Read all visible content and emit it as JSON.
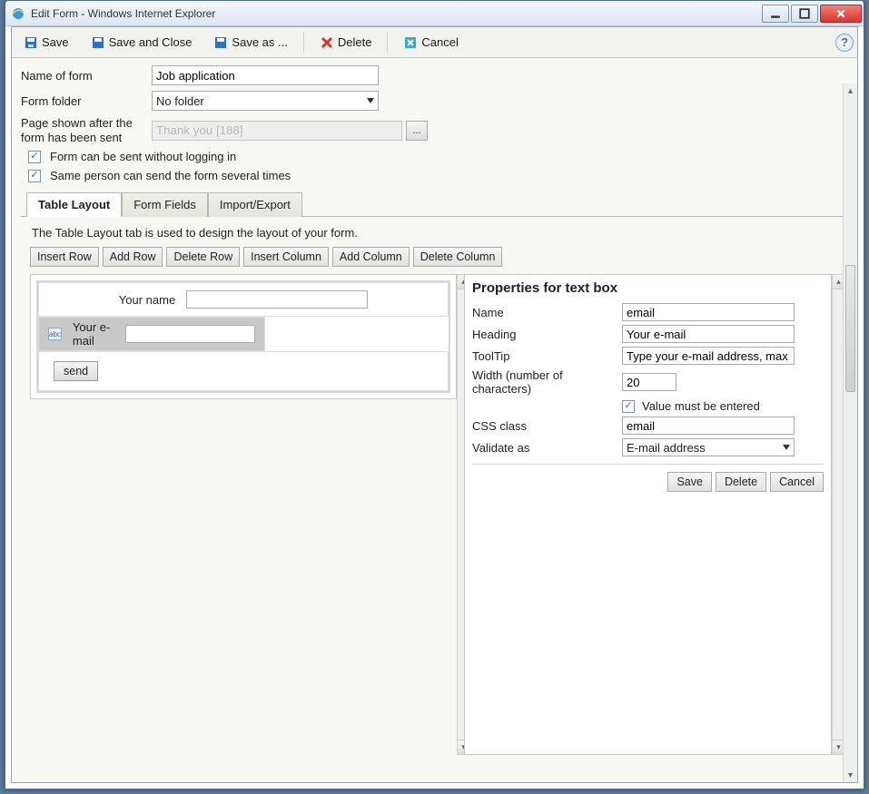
{
  "window": {
    "title": "Edit Form - Windows Internet Explorer"
  },
  "toolbar": {
    "save": "Save",
    "save_close": "Save and Close",
    "save_as": "Save as ...",
    "delete": "Delete",
    "cancel": "Cancel"
  },
  "form": {
    "name_label": "Name of form",
    "name_value": "Job application",
    "folder_label": "Form folder",
    "folder_value": "No folder",
    "page_label": "Page shown after the form has been sent",
    "page_value": "Thank you [188]",
    "browse": "...",
    "cb1": "Form can be sent without logging in",
    "cb2": "Same person can send the form several times"
  },
  "tabs": {
    "t1": "Table Layout",
    "t2": "Form Fields",
    "t3": "Import/Export",
    "desc": "The Table Layout tab is used to design the layout of your form."
  },
  "layout_btns": {
    "b1": "Insert Row",
    "b2": "Add Row",
    "b3": "Delete Row",
    "b4": "Insert Column",
    "b5": "Add Column",
    "b6": "Delete Column"
  },
  "preview": {
    "name_label": "Your name",
    "email_label": "Your e-mail",
    "send": "send",
    "abc": "abc"
  },
  "props": {
    "title": "Properties for text box",
    "name_l": "Name",
    "name_v": "email",
    "heading_l": "Heading",
    "heading_v": "Your e-mail",
    "tooltip_l": "ToolTip",
    "tooltip_v": "Type your e-mail address, max",
    "width_l": "Width (number of characters)",
    "width_v": "20",
    "must": "Value must be entered",
    "css_l": "CSS class",
    "css_v": "email",
    "validate_l": "Validate as",
    "validate_v": "E-mail address",
    "save": "Save",
    "delete": "Delete",
    "cancel": "Cancel"
  }
}
